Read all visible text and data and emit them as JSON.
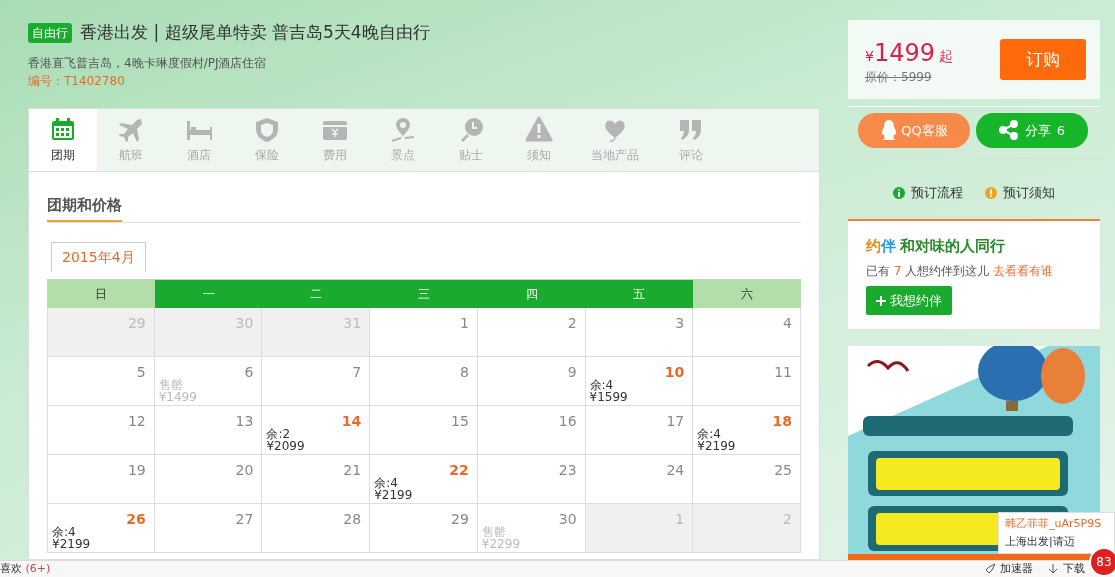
{
  "header": {
    "badge": "自由行",
    "title": "香港出发 | 超级尾单特卖 普吉岛5天4晚自由行",
    "subtitle": "香港直飞普吉岛，4晚卡琳度假村/PJ酒店住宿",
    "code": "编号：T1402780"
  },
  "price_box": {
    "currency": "¥",
    "price": "1499",
    "suffix": "起",
    "original": "原价：5999",
    "order_button": "订购"
  },
  "tabs": [
    {
      "label": "团期",
      "selected": true
    },
    {
      "label": "航班",
      "selected": false
    },
    {
      "label": "酒店",
      "selected": false
    },
    {
      "label": "保险",
      "selected": false
    },
    {
      "label": "费用",
      "selected": false
    },
    {
      "label": "景点",
      "selected": false
    },
    {
      "label": "贴士",
      "selected": false
    },
    {
      "label": "须知",
      "selected": false
    },
    {
      "label": "当地产品",
      "selected": false
    },
    {
      "label": "评论",
      "selected": false
    }
  ],
  "section_title": "团期和价格",
  "month_tab": "2015年4月",
  "calendar": {
    "weekdays": [
      {
        "label": "日",
        "weekend": true
      },
      {
        "label": "一",
        "weekend": false
      },
      {
        "label": "二",
        "weekend": false
      },
      {
        "label": "三",
        "weekend": false
      },
      {
        "label": "四",
        "weekend": false
      },
      {
        "label": "五",
        "weekend": false
      },
      {
        "label": "六",
        "weekend": true
      }
    ],
    "weeks": [
      [
        {
          "day": "29",
          "other_month": true
        },
        {
          "day": "30",
          "other_month": true
        },
        {
          "day": "31",
          "other_month": true
        },
        {
          "day": "1",
          "other_month": false
        },
        {
          "day": "2",
          "other_month": false
        },
        {
          "day": "3",
          "other_month": false
        },
        {
          "day": "4",
          "other_month": false
        }
      ],
      [
        {
          "day": "5",
          "other_month": false
        },
        {
          "day": "6",
          "other_month": false,
          "kind": "soldout",
          "status": "售罄",
          "price": "¥1499"
        },
        {
          "day": "7",
          "other_month": false
        },
        {
          "day": "8",
          "other_month": false
        },
        {
          "day": "9",
          "other_month": false
        },
        {
          "day": "10",
          "other_month": false,
          "kind": "available",
          "status": "余:4",
          "price": "¥1599"
        },
        {
          "day": "11",
          "other_month": false
        }
      ],
      [
        {
          "day": "12",
          "other_month": false
        },
        {
          "day": "13",
          "other_month": false
        },
        {
          "day": "14",
          "other_month": false,
          "kind": "available",
          "status": "余:2",
          "price": "¥2099"
        },
        {
          "day": "15",
          "other_month": false
        },
        {
          "day": "16",
          "other_month": false
        },
        {
          "day": "17",
          "other_month": false
        },
        {
          "day": "18",
          "other_month": false,
          "kind": "available",
          "status": "余:4",
          "price": "¥2199"
        }
      ],
      [
        {
          "day": "19",
          "other_month": false
        },
        {
          "day": "20",
          "other_month": false
        },
        {
          "day": "21",
          "other_month": false
        },
        {
          "day": "22",
          "other_month": false,
          "kind": "available",
          "status": "余:4",
          "price": "¥2199"
        },
        {
          "day": "23",
          "other_month": false
        },
        {
          "day": "24",
          "other_month": false
        },
        {
          "day": "25",
          "other_month": false
        }
      ],
      [
        {
          "day": "26",
          "other_month": false,
          "kind": "available",
          "status": "余:4",
          "price": "¥2199"
        },
        {
          "day": "27",
          "other_month": false
        },
        {
          "day": "28",
          "other_month": false
        },
        {
          "day": "29",
          "other_month": false
        },
        {
          "day": "30",
          "other_month": false,
          "kind": "soldout",
          "status": "售罄",
          "price": "¥2299"
        },
        {
          "day": "1",
          "other_month": true
        },
        {
          "day": "2",
          "other_month": true
        }
      ]
    ]
  },
  "social": {
    "qq_button": "QQ客服",
    "share_button": "分享",
    "share_count": "6"
  },
  "booking_links": [
    {
      "label": "预订流程",
      "kind": "info"
    },
    {
      "label": "预订须知",
      "kind": "warning"
    }
  ],
  "companion": {
    "logo_1": "约",
    "logo_2": "伴",
    "title": "和对味的人同行",
    "text_before": "已有",
    "count": "7",
    "text_after": "人想约伴到这儿",
    "link": "去看看有谁",
    "button": "我想约伴"
  },
  "popup": {
    "user": "韩乙菲菲_uAr5P9S",
    "message": "上海出发|请迈"
  },
  "status_bar": {
    "left": "喜欢",
    "left_count": "(6+)",
    "items": [
      "加速器",
      "下载"
    ],
    "badge": "83"
  }
}
